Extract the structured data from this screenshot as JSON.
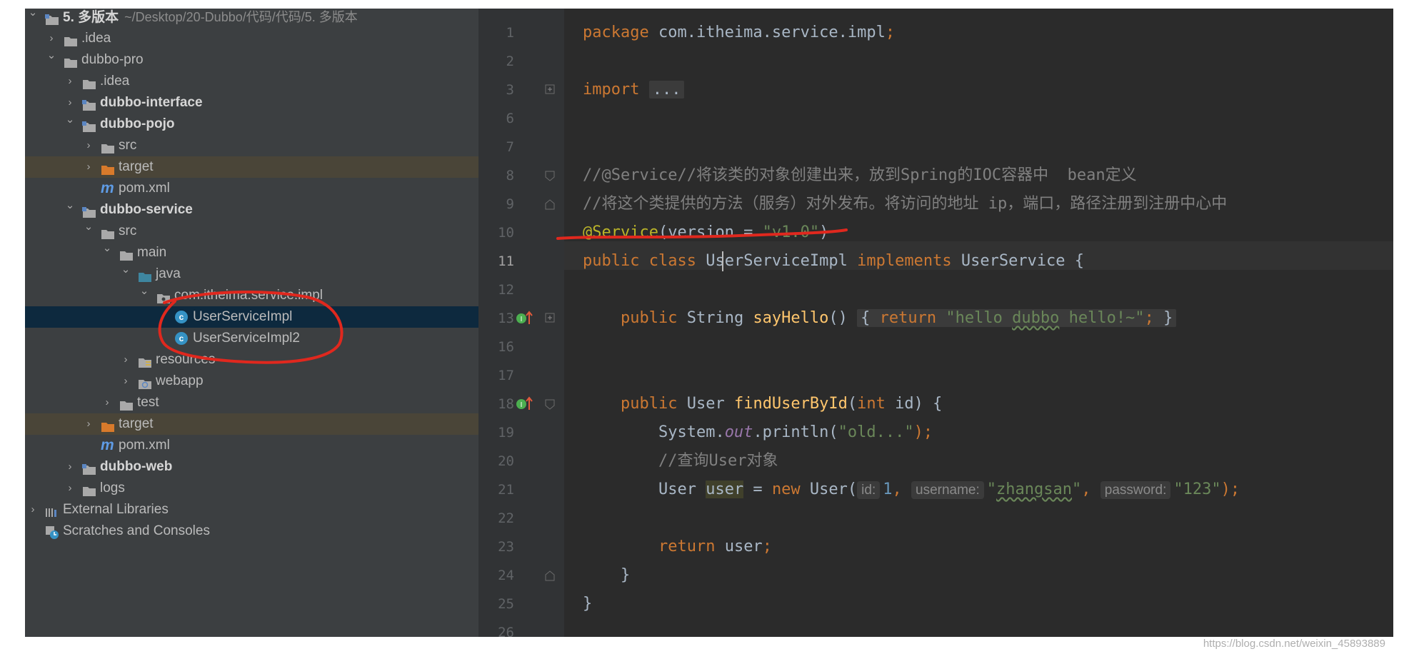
{
  "tree": [
    {
      "label": "5. 多版本",
      "path": "~/Desktop/20-Dubbo/代码/代码/5. 多版本",
      "icon": "module-folder-icon",
      "depth": 0,
      "expanded": true,
      "bold": true
    },
    {
      "label": ".idea",
      "icon": "folder-icon",
      "depth": 1,
      "expanded": false
    },
    {
      "label": "dubbo-pro",
      "icon": "folder-icon",
      "depth": 1,
      "expanded": true
    },
    {
      "label": ".idea",
      "icon": "folder-icon",
      "depth": 2,
      "expanded": false
    },
    {
      "label": "dubbo-interface",
      "icon": "module-folder-icon",
      "depth": 2,
      "expanded": false,
      "bold": true
    },
    {
      "label": "dubbo-pojo",
      "icon": "module-folder-icon",
      "depth": 2,
      "expanded": true,
      "bold": true
    },
    {
      "label": "src",
      "icon": "folder-icon",
      "depth": 3,
      "expanded": false
    },
    {
      "label": "target",
      "icon": "excluded-folder-icon",
      "depth": 3,
      "expanded": false,
      "highlight": "target"
    },
    {
      "label": "pom.xml",
      "icon": "maven-icon",
      "depth": 3
    },
    {
      "label": "dubbo-service",
      "icon": "module-folder-icon",
      "depth": 2,
      "expanded": true,
      "bold": true
    },
    {
      "label": "src",
      "icon": "folder-icon",
      "depth": 3,
      "expanded": true
    },
    {
      "label": "main",
      "icon": "folder-icon",
      "depth": 4,
      "expanded": true
    },
    {
      "label": "java",
      "icon": "source-folder-icon",
      "depth": 5,
      "expanded": true
    },
    {
      "label": "com.itheima.service.impl",
      "icon": "package-icon",
      "depth": 6,
      "expanded": true
    },
    {
      "label": "UserServiceImpl",
      "icon": "class-icon",
      "depth": 7,
      "highlight": "selected"
    },
    {
      "label": "UserServiceImpl2",
      "icon": "class-icon",
      "depth": 7
    },
    {
      "label": "resources",
      "icon": "resources-folder-icon",
      "depth": 5,
      "expanded": false
    },
    {
      "label": "webapp",
      "icon": "web-folder-icon",
      "depth": 5,
      "expanded": false
    },
    {
      "label": "test",
      "icon": "folder-icon",
      "depth": 4,
      "expanded": false
    },
    {
      "label": "target",
      "icon": "excluded-folder-icon",
      "depth": 3,
      "expanded": false,
      "highlight": "target"
    },
    {
      "label": "pom.xml",
      "icon": "maven-icon",
      "depth": 3
    },
    {
      "label": "dubbo-web",
      "icon": "module-folder-icon",
      "depth": 2,
      "expanded": false,
      "bold": true
    },
    {
      "label": "logs",
      "icon": "folder-icon",
      "depth": 2,
      "expanded": false
    },
    {
      "label": "External Libraries",
      "icon": "libraries-icon",
      "depth": 0,
      "expanded": false
    },
    {
      "label": "Scratches and Consoles",
      "icon": "scratches-icon",
      "depth": 0
    }
  ],
  "editor": {
    "line_numbers": [
      "1",
      "2",
      "3",
      "6",
      "7",
      "8",
      "9",
      "10",
      "11",
      "12",
      "13",
      "16",
      "17",
      "18",
      "19",
      "20",
      "21",
      "22",
      "23",
      "24",
      "25",
      "26"
    ],
    "current_line": "11",
    "code": {
      "l1_kw": "package",
      "l1_rest": " com.itheima.service.impl",
      "l1_semi": ";",
      "l3_kw": "import",
      "l3_fold": "...",
      "l8_comment": "//@Service//将该类的对象创建出来，放到Spring的IOC容器中  bean定义",
      "l9_comment": "//将这个类提供的方法（服务）对外发布。将访问的地址 ip，端口，路径注册到注册中心中",
      "l10_ann": "@Service",
      "l10_mid": "(version = ",
      "l10_str": "\"v1.0\"",
      "l10_end": ")",
      "l11_kw1": "public",
      "l11_kw2": "class",
      "l11_cls": "UserServiceImpl",
      "l11_kw3": "implements",
      "l11_rest": " UserService {",
      "l13_kw": "public",
      "l13_type": " String ",
      "l13_fn": "sayHello",
      "l13_paren": "()",
      "l13_brace1": "{",
      "l13_ret": "return",
      "l13_str1": "\"hello ",
      "l13_str2": "dubbo",
      "l13_str3": " hello!~\"",
      "l13_semi": ";",
      "l13_brace2": "}",
      "l18_kw": "public",
      "l18_type": " User ",
      "l18_fn": "findUserById",
      "l18_open": "(",
      "l18_int": "int",
      "l18_rest": " id) {",
      "l19_a": "System.",
      "l19_out": "out",
      "l19_b": ".println(",
      "l19_str": "\"old...\"",
      "l19_c": ");",
      "l20_comment": "//查询User对象",
      "l21_a": "User ",
      "l21_var": "user",
      "l21_b": " = ",
      "l21_new": "new",
      "l21_c": " User(",
      "l21_h1": "id:",
      "l21_n1": "1",
      "l21_comma1": ", ",
      "l21_h2": "username:",
      "l21_q1": "\"",
      "l21_s2": "zhangsan",
      "l21_q2": "\"",
      "l21_comma2": ", ",
      "l21_h3": "password:",
      "l21_s3": "\"123\"",
      "l21_end": ");",
      "l23_kw": "return",
      "l23_rest": " user",
      "l23_semi": ";",
      "l24": "}",
      "l25": "}"
    }
  },
  "watermark": "https://blog.csdn.net/weixin_45893889",
  "colors": {
    "keyword": "#cc7832",
    "string": "#6a8759",
    "annotation": "#bbb529",
    "function": "#ffc66d",
    "comment": "#808080",
    "marker_red": "#e0281e"
  }
}
